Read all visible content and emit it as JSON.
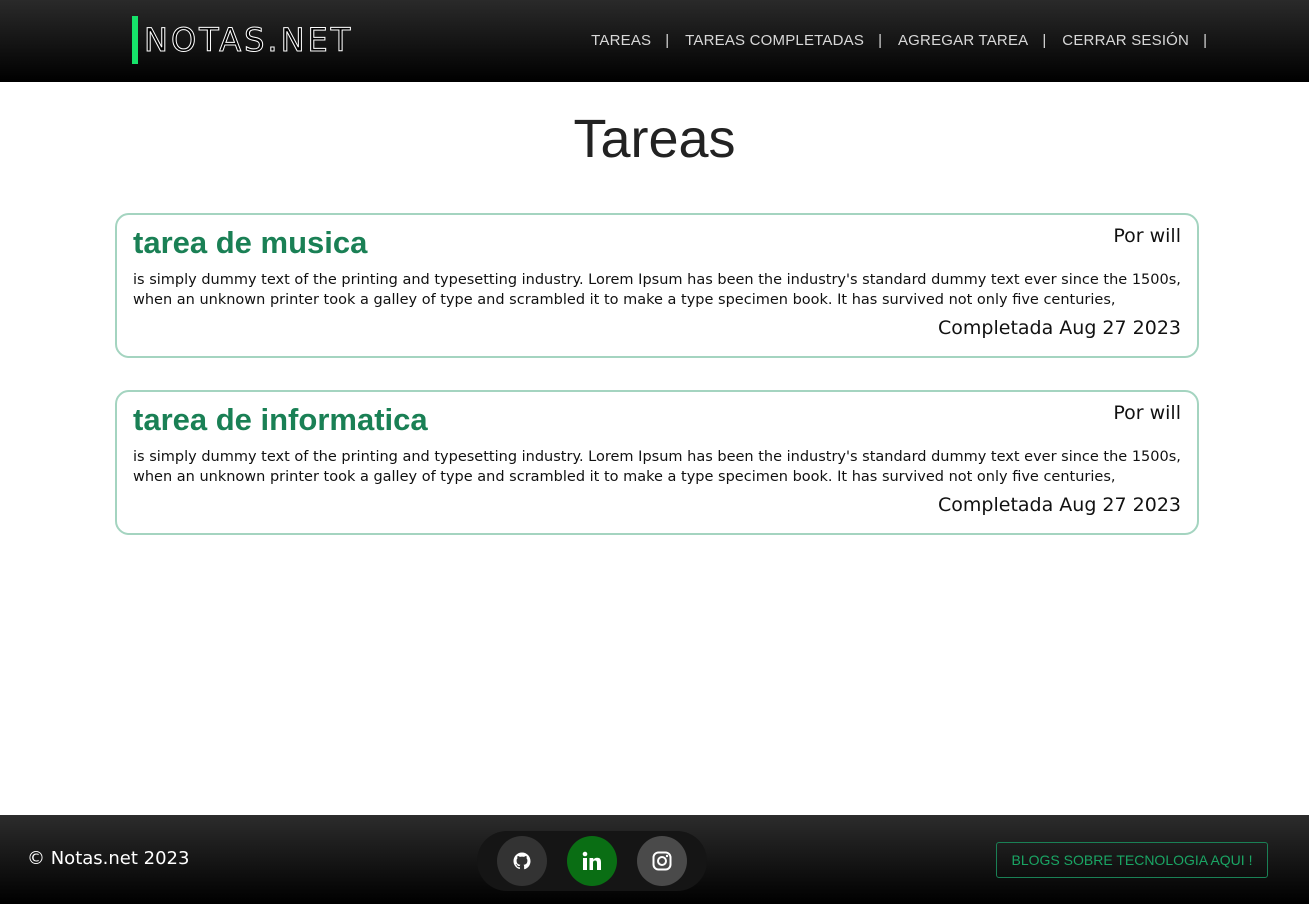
{
  "header": {
    "brand": "NOTAS.NET",
    "nav": [
      {
        "label": "TAREAS"
      },
      {
        "label": "TAREAS COMPLETADAS"
      },
      {
        "label": "AGREGAR TAREA"
      },
      {
        "label": "CERRAR SESIÓN"
      }
    ],
    "separator": "|"
  },
  "main": {
    "title": "Tareas",
    "tasks": [
      {
        "title": "tarea de musica",
        "author": "Por will",
        "description": "is simply dummy text of the printing and typesetting industry. Lorem Ipsum has been the industry's standard dummy text ever since the 1500s, when an unknown printer took a galley of type and scrambled it to make a type specimen book. It has survived not only five centuries,",
        "status": "Completada Aug 27 2023"
      },
      {
        "title": "tarea de informatica",
        "author": "Por will",
        "description": "is simply dummy text of the printing and typesetting industry. Lorem Ipsum has been the industry's standard dummy text ever since the 1500s, when an unknown printer took a galley of type and scrambled it to make a type specimen book. It has survived not only five centuries,",
        "status": "Completada Aug 27 2023"
      }
    ]
  },
  "footer": {
    "copyright": "© Notas.net 2023",
    "social": [
      {
        "icon": "github-icon"
      },
      {
        "icon": "linkedin-icon"
      },
      {
        "icon": "instagram-icon"
      }
    ],
    "blogs_label": "BLOGS SOBRE TECNOLOGIA AQUI !"
  },
  "colors": {
    "accent": "#16e36a",
    "task_title": "#1a8055",
    "card_border": "#a4d4c0",
    "linkedin_bg": "#0a6e14"
  }
}
